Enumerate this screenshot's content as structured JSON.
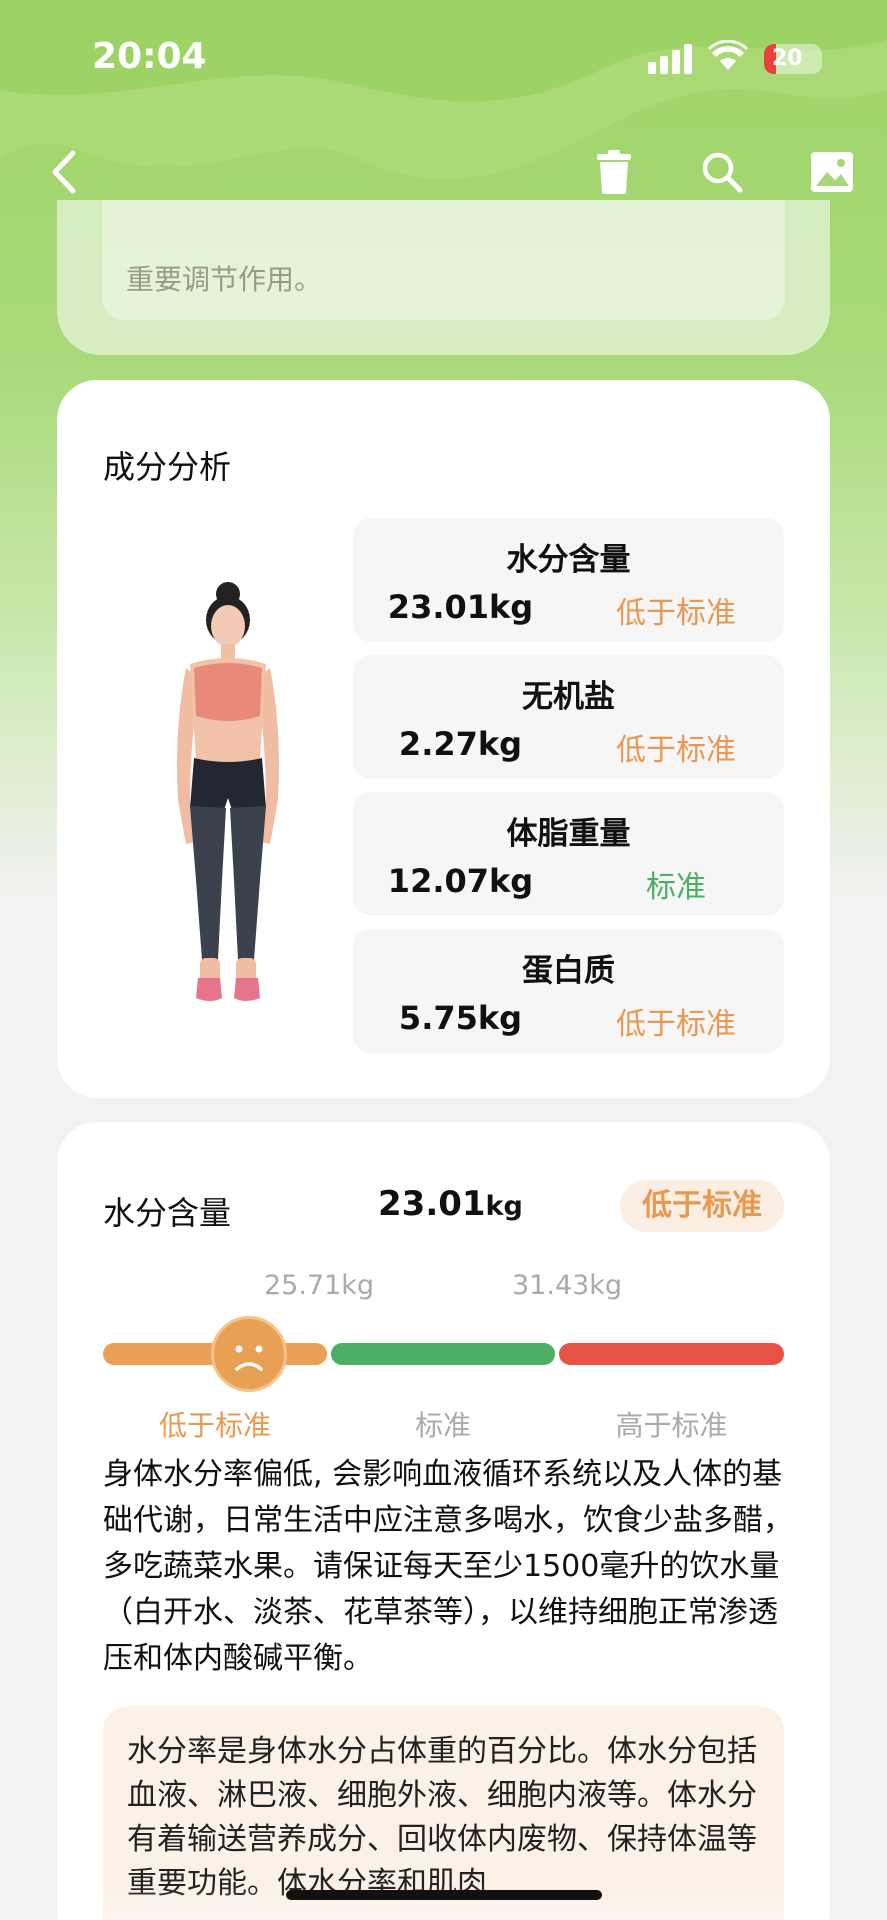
{
  "status": {
    "time": "20:04",
    "battery": "20"
  },
  "nav": {
    "back_icon": "chevron-left-icon",
    "delete_icon": "trash-icon",
    "search_icon": "search-icon",
    "image_icon": "image-icon"
  },
  "top_card": {
    "line": "重要调节作用。"
  },
  "composition": {
    "title": "成分分析",
    "items": [
      {
        "name": "水分含量",
        "value": "23.01kg",
        "status": "低于标准",
        "status_color": "#e8994f"
      },
      {
        "name": "无机盐",
        "value": "2.27kg",
        "status": "低于标准",
        "status_color": "#e8994f"
      },
      {
        "name": "体脂重量",
        "value": "12.07kg",
        "status": "标准",
        "status_color": "#4caf63"
      },
      {
        "name": "蛋白质",
        "value": "5.75kg",
        "status": "低于标准",
        "status_color": "#e8994f"
      }
    ]
  },
  "water": {
    "label": "水分含量",
    "value": "23.01",
    "unit": "kg",
    "status": "低于标准",
    "threshold_low": "25.71kg",
    "threshold_high": "31.43kg",
    "zones": [
      "低于标准",
      "标准",
      "高于标准"
    ],
    "zone_colors": [
      "#e8a055",
      "#4caf63",
      "#e65345"
    ],
    "marker_face": "sad-face-icon",
    "description": "身体水分率偏低, 会影响血液循环系统以及人体的基础代谢，日常生活中应注意多喝水，饮食少盐多醋，多吃蔬菜水果。请保证每天至少1500毫升的饮水量（白开水、淡茶、花草茶等），以维持细胞正常渗透压和体内酸碱平衡。",
    "info": "水分率是身体水分占体重的百分比。体水分包括血液、淋巴液、细胞外液、细胞内液等。体水分有着输送营养成分、回收体内废物、保持体温等重要功能。体水分率和肌肉"
  }
}
